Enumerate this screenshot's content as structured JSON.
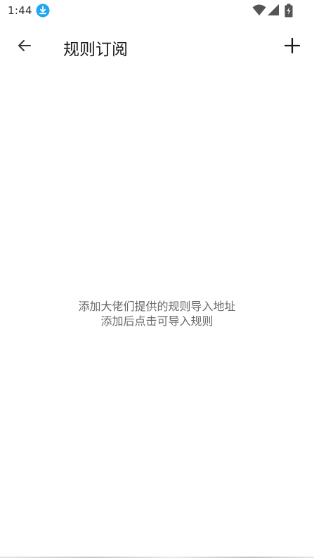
{
  "status_bar": {
    "time": "1:44",
    "icons": [
      "download-icon",
      "wifi-icon",
      "cell-signal-icon",
      "battery-charging-icon"
    ],
    "download_color": "#1ea7f2"
  },
  "app_bar": {
    "title": "规则订阅",
    "back_icon": "arrow-left-icon",
    "add_icon": "plus-icon"
  },
  "empty_state": {
    "line1": "添加大佬们提供的规则导入地址",
    "line2": "添加后点击可导入规则"
  }
}
